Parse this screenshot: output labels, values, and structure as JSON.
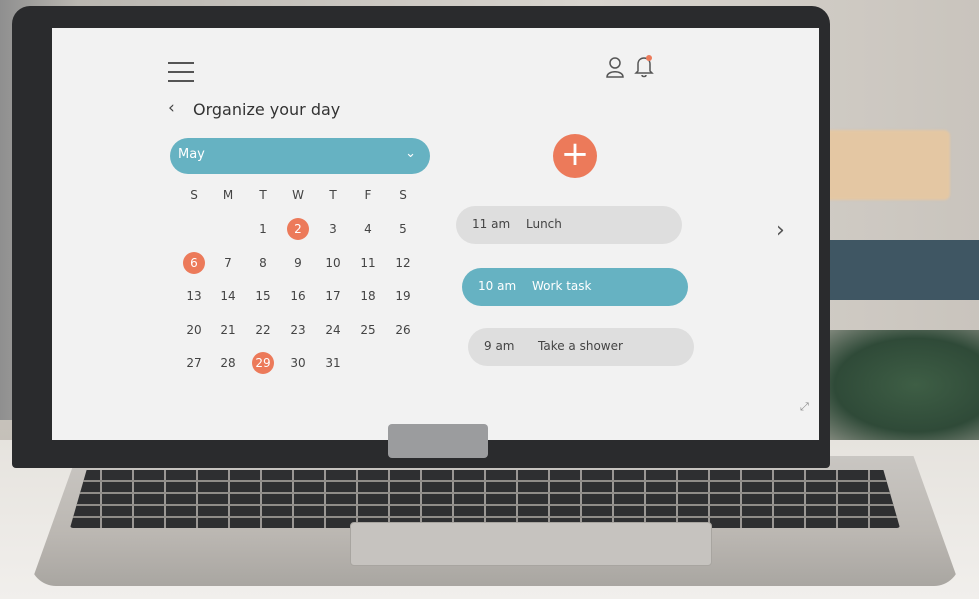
{
  "header": {
    "title": "Organize your day"
  },
  "calendar": {
    "month": "May",
    "weekdays": [
      "S",
      "M",
      "T",
      "W",
      "T",
      "F",
      "S"
    ],
    "weeks": [
      [
        "",
        "",
        "1",
        "2",
        "3",
        "4",
        "5"
      ],
      [
        "6",
        "7",
        "8",
        "9",
        "10",
        "11",
        "12"
      ],
      [
        "13",
        "14",
        "15",
        "16",
        "17",
        "18",
        "19"
      ],
      [
        "20",
        "21",
        "22",
        "23",
        "24",
        "25",
        "26"
      ],
      [
        "27",
        "28",
        "29",
        "30",
        "31",
        "",
        ""
      ]
    ],
    "highlighted": [
      "2",
      "6",
      "29"
    ]
  },
  "add_button": {
    "label": "+"
  },
  "tasks": [
    {
      "time": "11 am",
      "name": "Lunch",
      "active": false
    },
    {
      "time": "10 am",
      "name": "Work task",
      "active": true
    },
    {
      "time": "9 am",
      "name": "Take a shower",
      "active": false
    }
  ],
  "colors": {
    "accent": "#66b2c2",
    "highlight": "#ec7a5a"
  },
  "icons": [
    "menu-icon",
    "user-icon",
    "bell-icon",
    "back-arrow-icon",
    "chevron-down-icon",
    "next-arrow-icon",
    "resize-icon"
  ]
}
